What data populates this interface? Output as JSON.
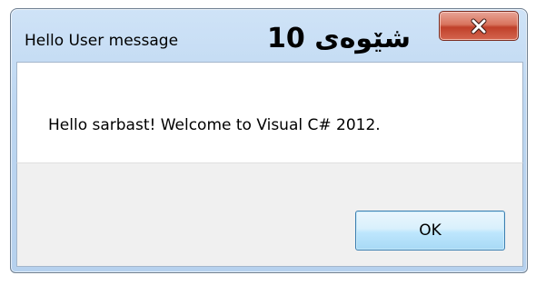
{
  "window": {
    "title": "Hello User message",
    "overlay_text": "شێوەی 10",
    "message": "Hello sarbast! Welcome to Visual C# 2012.",
    "ok_label": "OK",
    "close_icon": "close-x-icon"
  },
  "colors": {
    "title_bar": "#bcd6f1",
    "close_button": "#c75a44",
    "ok_button": "#bee6fd",
    "footer": "#f0f0f0"
  }
}
